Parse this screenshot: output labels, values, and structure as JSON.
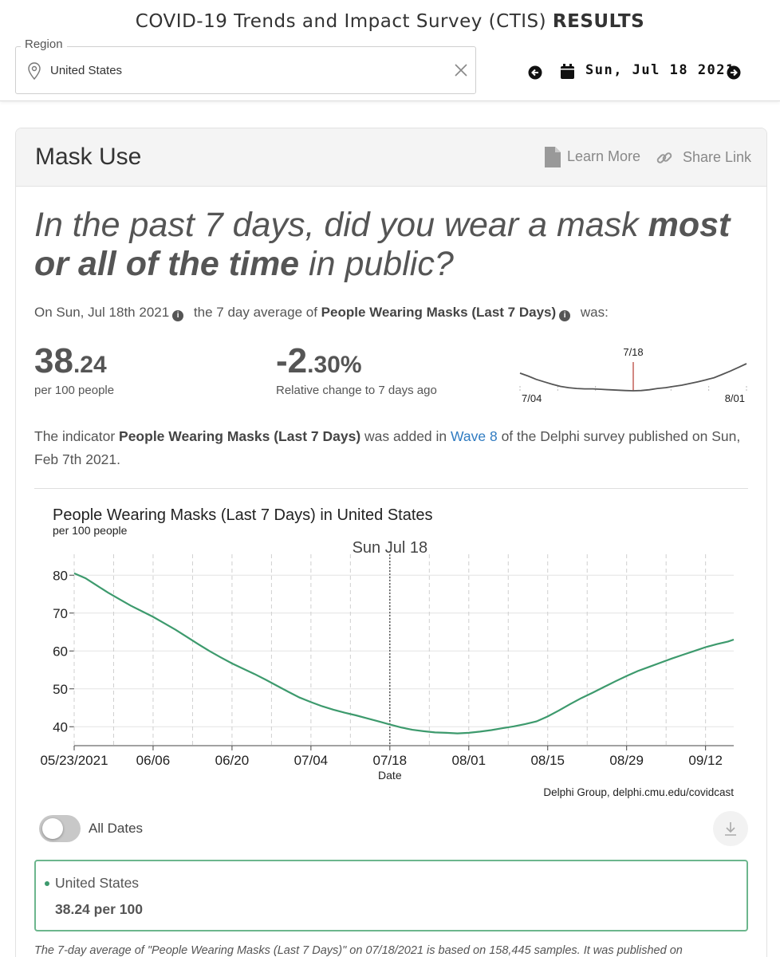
{
  "header": {
    "title": "COVID-19 Trends and Impact Survey (CTIS)",
    "title_bold": "RESULTS",
    "region_label": "Region",
    "region_value": "United States",
    "date": "Sun, Jul 18 2021"
  },
  "card": {
    "title": "Mask Use",
    "learn_more": "Learn More",
    "share_link": "Share Link",
    "question_part1": "In the past 7 days, did you wear a mask ",
    "question_bold": "most or all of the time",
    "question_part2": " in public?",
    "summary_prefix": "On Sun, Jul 18th 2021",
    "summary_mid": "the 7 day average of",
    "summary_indicator": "People Wearing Masks (Last 7 Days)",
    "summary_suffix": "was:",
    "value_int": "38",
    "value_dec": ".24",
    "value_unit": "per 100 people",
    "change_int": "-2",
    "change_dec": ".30%",
    "change_label": "Relative change to 7 days ago",
    "added_1": "The indicator ",
    "added_indicator": "People Wearing Masks (Last 7 Days)",
    "added_2": " was added in ",
    "added_wave": "Wave 8",
    "added_3": " of the Delphi survey published on Sun, Feb 7th 2021.",
    "toggle_label": "All Dates",
    "legend_region": "United States",
    "legend_value": "38.24 per 100",
    "footnote": "The 7-day average of \"People Wearing Masks (Last 7 Days)\" on 07/18/2021 is based on 158,445 samples. It was published on"
  },
  "sparkline": {
    "marker_label": "7/18",
    "start_label": "7/04",
    "end_label": "8/01",
    "x": [
      0,
      1,
      2,
      3,
      4,
      5,
      6,
      7,
      8,
      9,
      10,
      11,
      12,
      13,
      14,
      15,
      16,
      17,
      18,
      19,
      20,
      21,
      22,
      23,
      24,
      25,
      26,
      27,
      28
    ],
    "values": [
      42.5,
      41.8,
      41.0,
      40.4,
      39.8,
      39.3,
      39.0,
      38.8,
      38.7,
      38.7,
      38.6,
      38.5,
      38.4,
      38.3,
      38.24,
      38.3,
      38.5,
      38.8,
      39.0,
      39.3,
      39.6,
      40.0,
      40.4,
      40.9,
      41.4,
      42.2,
      43.0,
      43.9,
      44.8
    ],
    "marker_x": 14,
    "colors": {
      "line": "#555555",
      "marker": "#b33a2e"
    }
  },
  "chart_data": {
    "type": "line",
    "title": "People Wearing Masks (Last 7 Days) in United States",
    "subtitle": "per 100 people",
    "xlabel": "Date",
    "ylabel": "",
    "source": "Delphi Group, delphi.cmu.edu/covidcast",
    "marker_label": "Sun Jul 18",
    "marker_x": "07/18",
    "x_tick_labels": [
      "05/23/2021",
      "06/06",
      "06/20",
      "07/04",
      "07/18",
      "08/01",
      "08/15",
      "08/29",
      "09/12"
    ],
    "y_ticks": [
      40,
      50,
      60,
      70,
      80
    ],
    "ylim": [
      35,
      83
    ],
    "xlim": [
      "2021-05-23",
      "2021-09-17"
    ],
    "grid": true,
    "x": [
      "2021-05-23",
      "2021-05-25",
      "2021-05-27",
      "2021-05-29",
      "2021-05-31",
      "2021-06-02",
      "2021-06-04",
      "2021-06-06",
      "2021-06-08",
      "2021-06-10",
      "2021-06-12",
      "2021-06-14",
      "2021-06-16",
      "2021-06-18",
      "2021-06-20",
      "2021-06-22",
      "2021-06-24",
      "2021-06-26",
      "2021-06-28",
      "2021-06-30",
      "2021-07-02",
      "2021-07-04",
      "2021-07-06",
      "2021-07-08",
      "2021-07-10",
      "2021-07-12",
      "2021-07-14",
      "2021-07-16",
      "2021-07-18",
      "2021-07-20",
      "2021-07-22",
      "2021-07-24",
      "2021-07-26",
      "2021-07-28",
      "2021-07-30",
      "2021-08-01",
      "2021-08-03",
      "2021-08-05",
      "2021-08-07",
      "2021-08-09",
      "2021-08-11",
      "2021-08-13",
      "2021-08-15",
      "2021-08-17",
      "2021-08-19",
      "2021-08-21",
      "2021-08-23",
      "2021-08-25",
      "2021-08-27",
      "2021-08-29",
      "2021-08-31",
      "2021-09-02",
      "2021-09-04",
      "2021-09-06",
      "2021-09-08",
      "2021-09-10",
      "2021-09-12",
      "2021-09-14",
      "2021-09-16",
      "2021-09-17"
    ],
    "series": [
      {
        "values": [
          80.5,
          79.2,
          77.3,
          75.4,
          73.7,
          72.0,
          70.5,
          69.0,
          67.3,
          65.6,
          63.7,
          61.8,
          60.0,
          58.3,
          56.7,
          55.3,
          53.9,
          52.4,
          50.8,
          49.2,
          47.7,
          46.5,
          45.4,
          44.5,
          43.7,
          43.0,
          42.2,
          41.4,
          40.6,
          39.8,
          39.2,
          38.8,
          38.5,
          38.4,
          38.24,
          38.4,
          38.7,
          39.1,
          39.6,
          40.1,
          40.7,
          41.4,
          42.7,
          44.3,
          46.0,
          47.6,
          49.0,
          50.5,
          52.0,
          53.4,
          54.7,
          55.8,
          56.9,
          58.0,
          59.0,
          60.0,
          61.0,
          61.8,
          62.5,
          63.0
        ],
        "color": "#3d9a6d"
      }
    ]
  },
  "colors": {
    "accent": "#2f7bc1",
    "series": "#3d9a6d",
    "legend_border": "#6cb68d"
  }
}
